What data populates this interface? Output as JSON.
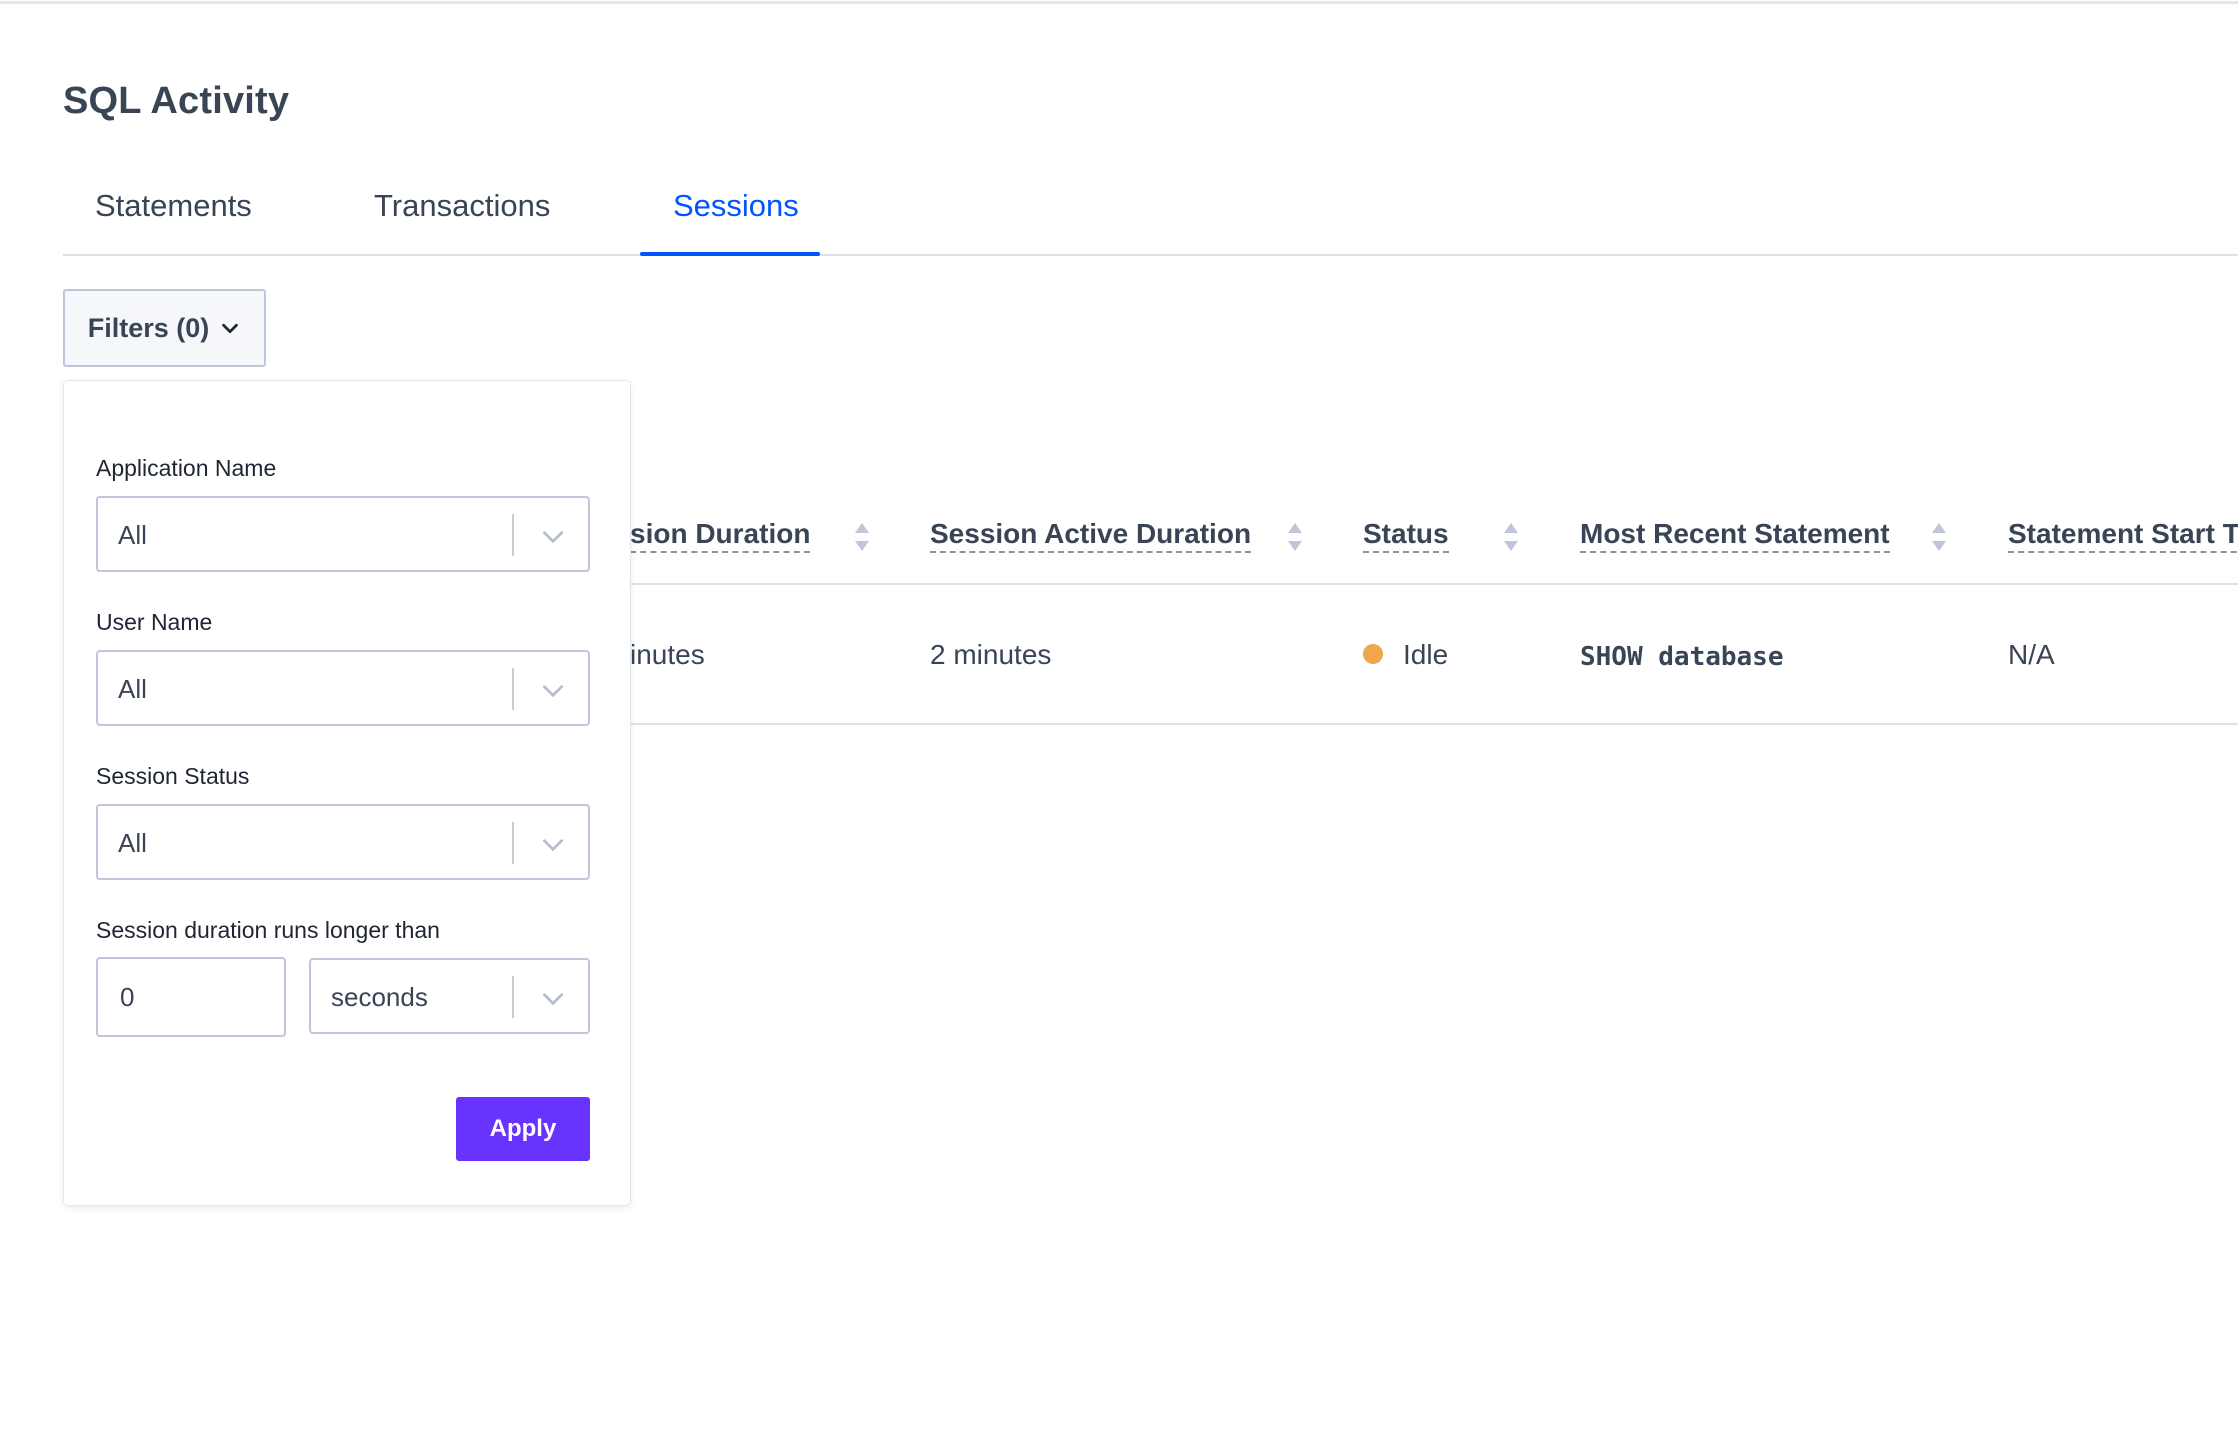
{
  "page": {
    "title": "SQL Activity"
  },
  "tabs": [
    {
      "label": "Statements",
      "active": false
    },
    {
      "label": "Transactions",
      "active": false
    },
    {
      "label": "Sessions",
      "active": true
    }
  ],
  "filters_button": {
    "label": "Filters (0)"
  },
  "filter_panel": {
    "application_name": {
      "label": "Application Name",
      "value": "All"
    },
    "user_name": {
      "label": "User Name",
      "value": "All"
    },
    "session_status": {
      "label": "Session Status",
      "value": "All"
    },
    "duration": {
      "label": "Session duration runs longer than",
      "value": "0",
      "unit": "seconds"
    },
    "apply_label": "Apply"
  },
  "table": {
    "columns": [
      "sion Duration",
      "Session Active Duration",
      "Status",
      "Most Recent Statement",
      "Statement Start Ti"
    ],
    "rows": [
      {
        "session_duration": "inutes",
        "session_active_duration": "2 minutes",
        "status": "Idle",
        "most_recent_statement": "SHOW database",
        "statement_start_time": "N/A"
      }
    ]
  },
  "colors": {
    "accent": "#0055ff",
    "apply_button": "#6933ff",
    "status_idle": "#f0a64a",
    "text": "#394455"
  }
}
